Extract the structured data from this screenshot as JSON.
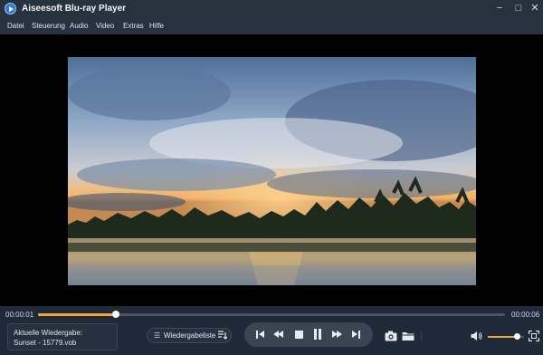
{
  "window": {
    "title": "Aiseesoft Blu-ray Player",
    "minimize_glyph": "−",
    "maximize_glyph": "□",
    "close_glyph": "✕"
  },
  "menu": {
    "items": [
      "Datei",
      "Steuerung",
      "Audio",
      "Video",
      "Extras",
      "Hilfe"
    ]
  },
  "player": {
    "elapsed": "00:00:01",
    "duration": "00:00:06",
    "progress_fraction": 0.167,
    "volume_fraction": 0.8,
    "now_playing_line1": "Aktuelle Wiedergabe:",
    "now_playing_line2": "Sunset - 15779.vob",
    "playlist_label": "Wiedergabeliste",
    "state": "playing"
  },
  "icons": {
    "app": "play-logo-icon",
    "playlist_left": "list-icon",
    "playlist_right": "playlist-icon",
    "prev": "skip-previous-icon",
    "rewind": "rewind-icon",
    "stop": "stop-icon",
    "pause": "pause-icon",
    "forward": "fast-forward-icon",
    "next": "skip-next-icon",
    "snapshot": "camera-icon",
    "folder": "folder-icon",
    "volume": "volume-icon",
    "fullscreen": "fullscreen-icon"
  },
  "colors": {
    "accent": "#f2a53a",
    "background": "#1f2938",
    "titlebar": "#27323f"
  }
}
